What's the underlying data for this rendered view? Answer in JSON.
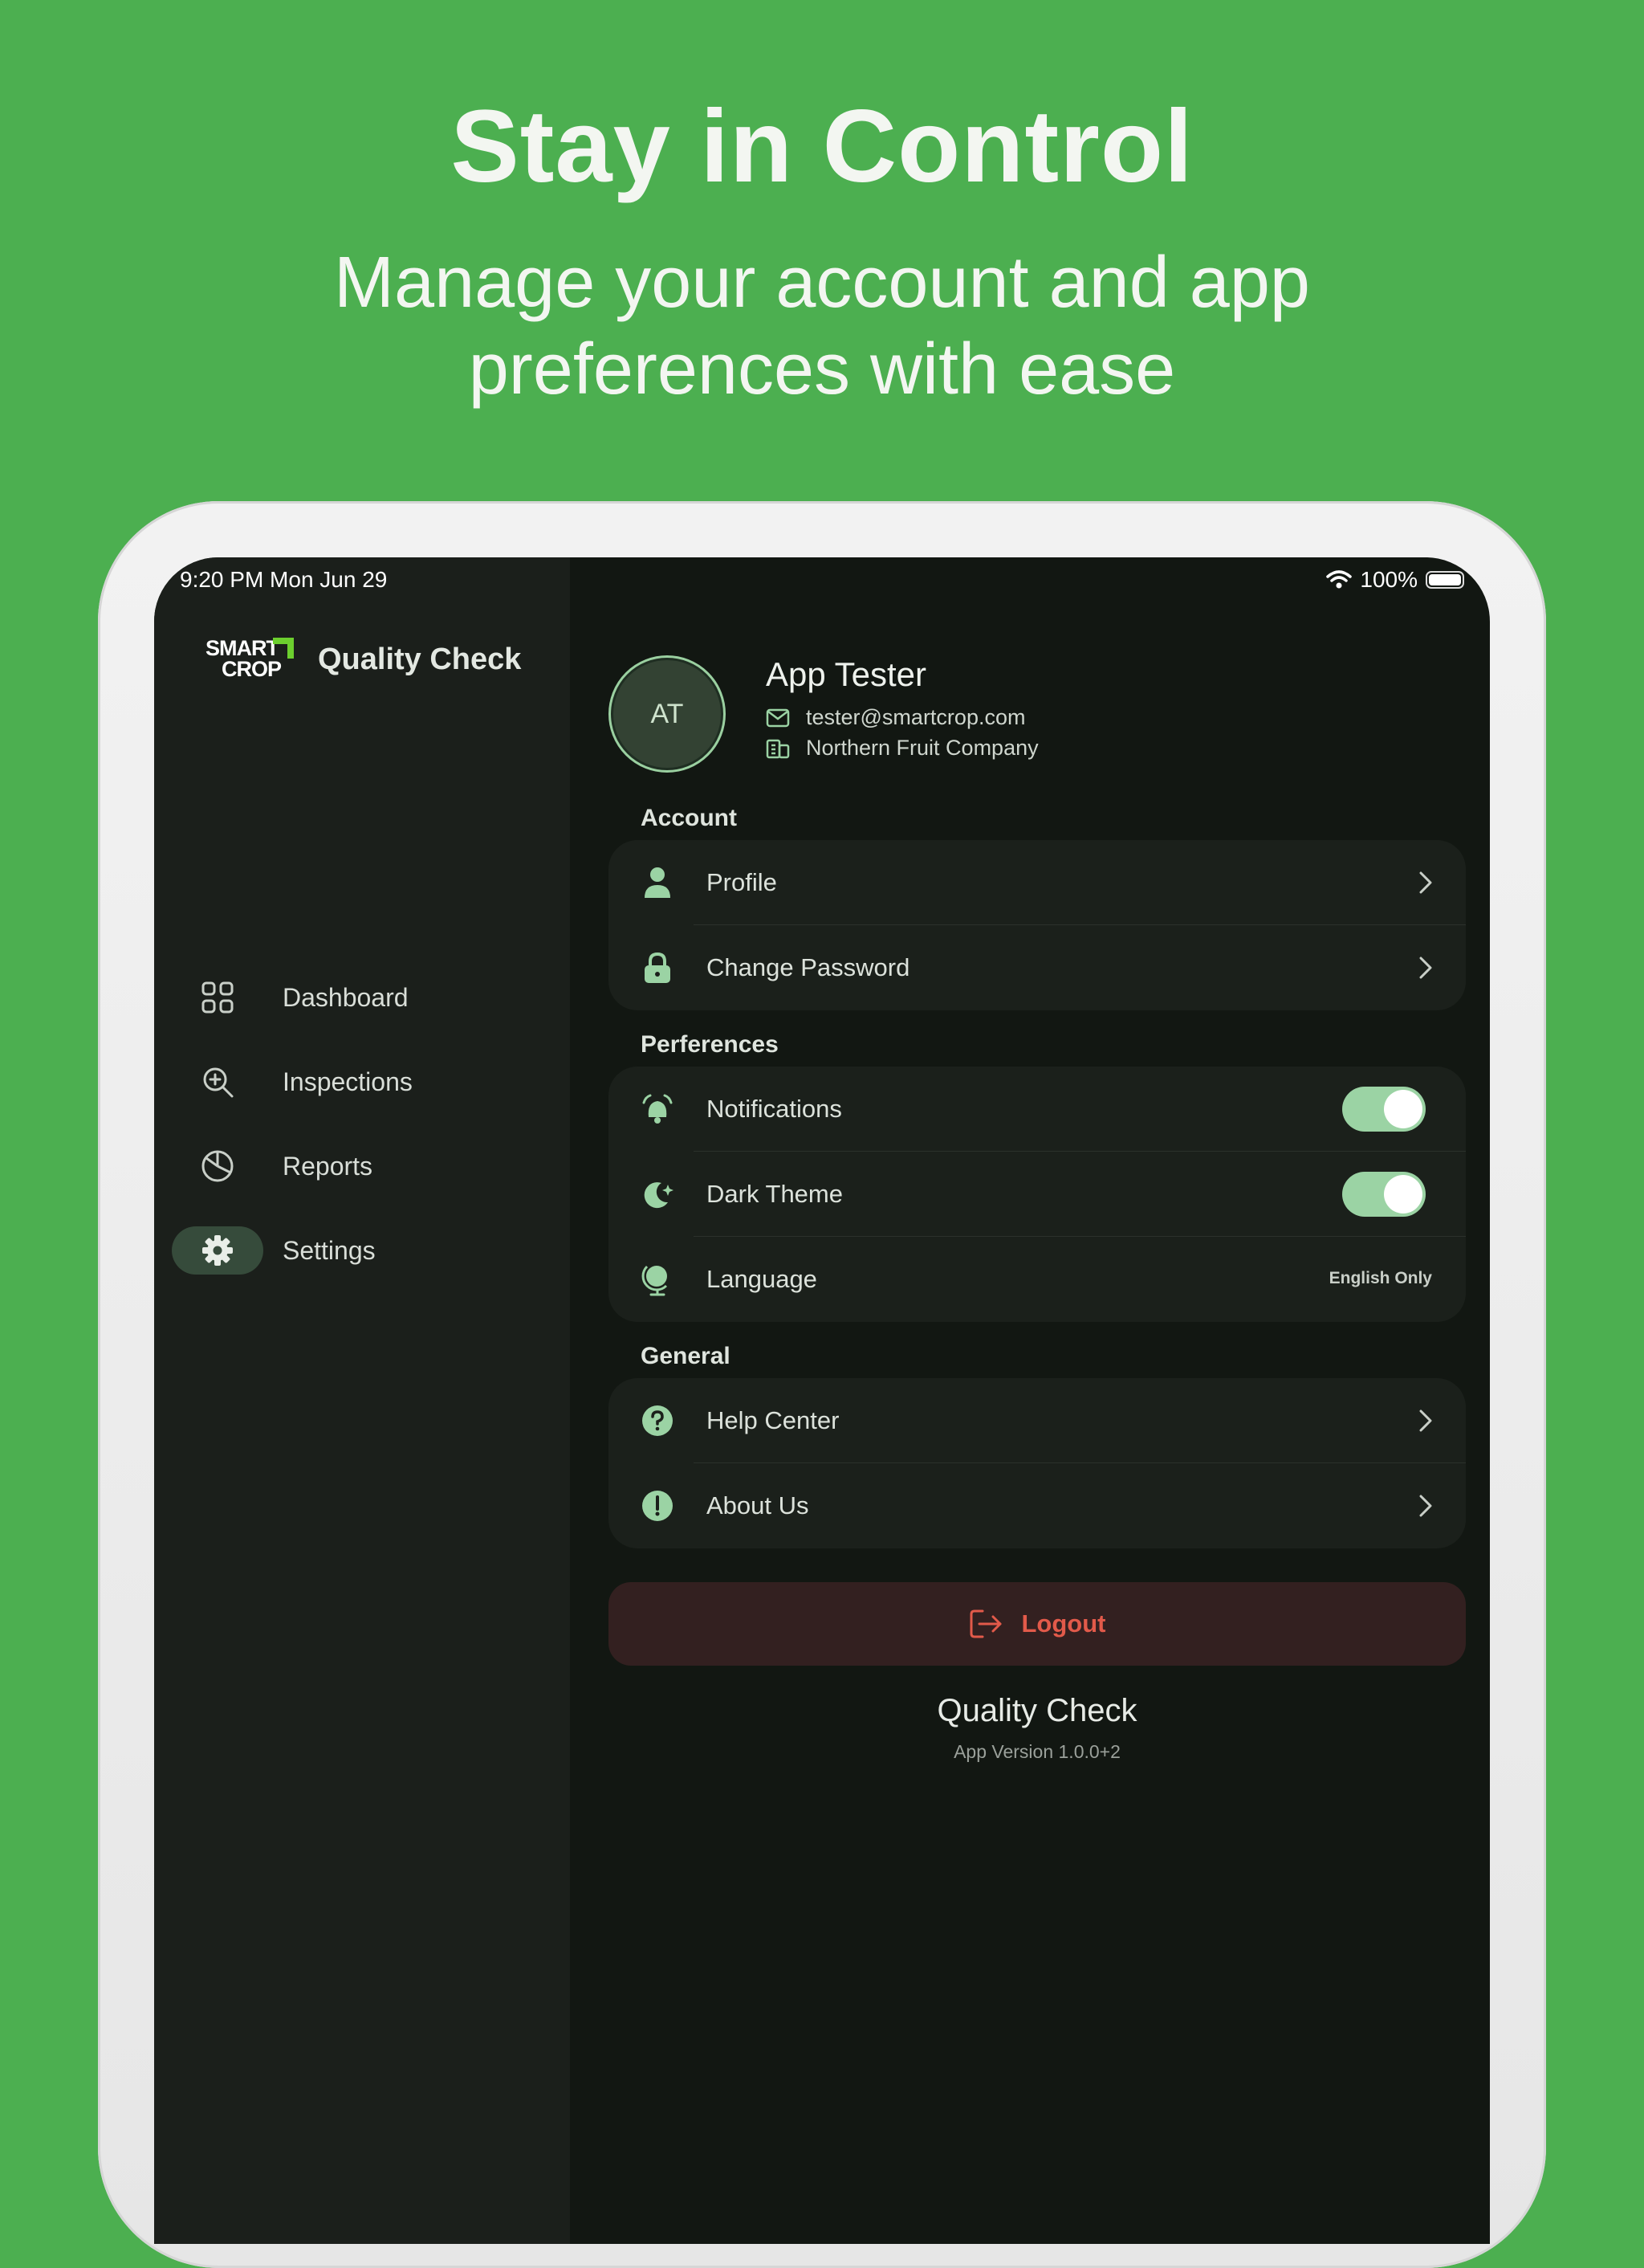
{
  "marketing": {
    "title": "Stay in Control",
    "subtitle_line1": "Manage your account and app",
    "subtitle_line2": "preferences with ease"
  },
  "statusbar": {
    "time": "9:20 PM  Mon Jun 29",
    "battery": "100%"
  },
  "brand": {
    "logo_line1": "SMART",
    "logo_line2": "CROP",
    "app_name": "Quality Check"
  },
  "sidebar": {
    "items": [
      {
        "label": "Dashboard",
        "icon": "grid-icon"
      },
      {
        "label": "Inspections",
        "icon": "search-plus-icon"
      },
      {
        "label": "Reports",
        "icon": "pie-chart-icon"
      },
      {
        "label": "Settings",
        "icon": "gear-icon",
        "active": true
      }
    ]
  },
  "profile": {
    "initials": "AT",
    "name": "App Tester",
    "email": "tester@smartcrop.com",
    "company": "Northern Fruit Company"
  },
  "sections": {
    "account": {
      "title": "Account",
      "items": [
        {
          "label": "Profile",
          "icon": "person-icon"
        },
        {
          "label": "Change Password",
          "icon": "lock-icon"
        }
      ]
    },
    "preferences": {
      "title": "Perferences",
      "items": [
        {
          "label": "Notifications",
          "icon": "bell-icon",
          "toggle": true
        },
        {
          "label": "Dark Theme",
          "icon": "moon-icon",
          "toggle": true
        },
        {
          "label": "Language",
          "icon": "globe-icon",
          "value": "English Only"
        }
      ]
    },
    "general": {
      "title": "General",
      "items": [
        {
          "label": "Help Center",
          "icon": "question-icon"
        },
        {
          "label": "About Us",
          "icon": "info-icon"
        }
      ]
    }
  },
  "logout_label": "Logout",
  "footer": {
    "title": "Quality Check",
    "version": "App Version 1.0.0+2"
  },
  "colors": {
    "background": "#4caf50",
    "sidebar": "#1b1f1b",
    "main": "#121712",
    "accent": "#9bd3a4",
    "logout_text": "#e25a4a",
    "logout_bg": "#332020"
  }
}
